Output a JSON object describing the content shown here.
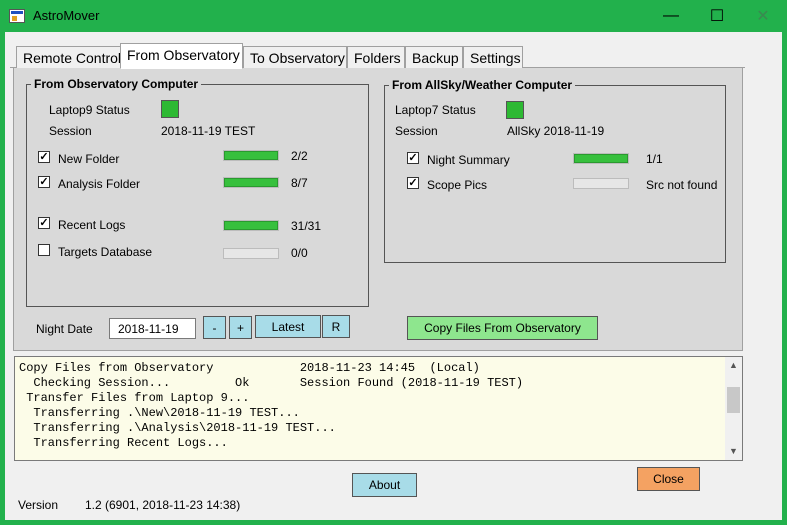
{
  "window": {
    "title": "AstroMover",
    "minimize_glyph": "—",
    "maximize_glyph": "☐",
    "close_glyph": "✕"
  },
  "tabs": [
    {
      "label": "Remote Control",
      "active": false
    },
    {
      "label": "From Observatory",
      "active": true
    },
    {
      "label": "To Observatory",
      "active": false
    },
    {
      "label": "Folders",
      "active": false
    },
    {
      "label": "Backup",
      "active": false
    },
    {
      "label": "Settings",
      "active": false
    }
  ],
  "obs_group": {
    "title": "From Observatory Computer",
    "status_label": "Laptop9 Status",
    "status_color": "#2db933",
    "session_label": "Session",
    "session_value": "2018-11-19 TEST",
    "items": [
      {
        "label": "New Folder",
        "checked": true,
        "progress": 1.0,
        "count": "2/2"
      },
      {
        "label": "Analysis Folder",
        "checked": true,
        "progress": 1.0,
        "count": "8/7"
      },
      {
        "label": "Recent Logs",
        "checked": true,
        "progress": 1.0,
        "count": "31/31"
      },
      {
        "label": "Targets Database",
        "checked": false,
        "progress": 0.0,
        "count": "0/0"
      }
    ]
  },
  "allsky_group": {
    "title": "From AllSky/Weather Computer",
    "status_label": "Laptop7 Status",
    "status_color": "#2db933",
    "session_label": "Session",
    "session_value": "AllSky 2018-11-19",
    "items": [
      {
        "label": "Night Summary",
        "checked": true,
        "progress": 1.0,
        "count": "1/1"
      },
      {
        "label": "Scope Pics",
        "checked": true,
        "progress": 0.0,
        "count": "Src not found"
      }
    ]
  },
  "night": {
    "label": "Night Date",
    "value": "2018-11-19",
    "minus_label": "-",
    "plus_label": "+",
    "latest_label": "Latest",
    "r_label": "R"
  },
  "copy_button": "Copy Files From Observatory",
  "log_lines": [
    "Copy Files from Observatory            2018-11-23 14:45  (Local)",
    "  Checking Session...         Ok       Session Found (2018-11-19 TEST)",
    " Transfer Files from Laptop 9...",
    "  Transferring .\\New\\2018-11-19 TEST...",
    "  Transferring .\\Analysis\\2018-11-19 TEST...",
    "  Transferring Recent Logs..."
  ],
  "about_button": "About",
  "close_button": "Close",
  "version_label": "Version",
  "version_value": "1.2  (6901,  2018-11-23 14:38)",
  "colors": {
    "titlebar": "#22b14c",
    "copy_button": "#8ee68e",
    "about_button": "#a8dce8",
    "close_button": "#f4a262",
    "log_background": "#fcfce8"
  }
}
